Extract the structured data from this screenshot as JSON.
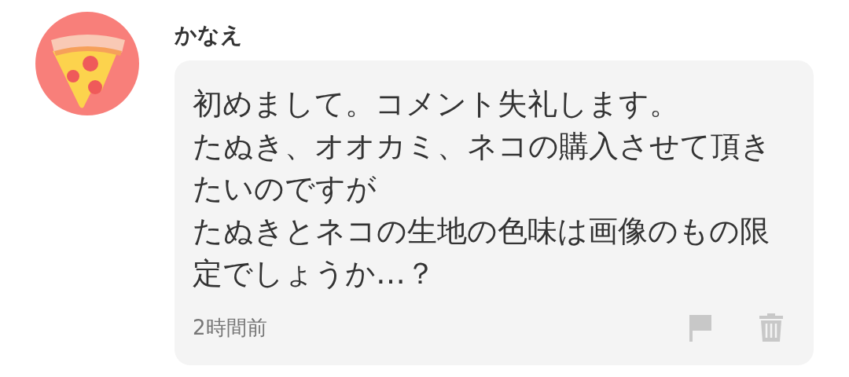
{
  "comment": {
    "author": "かなえ",
    "lines": [
      "初めまして。コメント失礼します。",
      "たぬき、オオカミ、ネコの購入させて頂きたいのですが",
      "たぬきとネコの生地の色味は画像のもの限定でしょうか…？"
    ],
    "time": "2時間前"
  }
}
